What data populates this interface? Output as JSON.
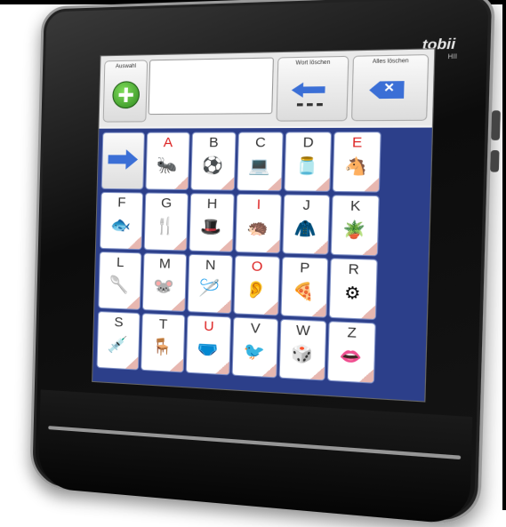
{
  "device": {
    "brand": "tobii",
    "model": "HII"
  },
  "topbar": {
    "choose_label": "Auswahl",
    "delete_word_label": "Wort löschen",
    "delete_all_label": "Alles löschen",
    "message_text": ""
  },
  "grid": {
    "next_label": "",
    "rows": [
      [
        {
          "letter": "A",
          "red": true,
          "icon": "ant"
        },
        {
          "letter": "B",
          "red": false,
          "icon": "ball"
        },
        {
          "letter": "C",
          "red": false,
          "icon": "computer"
        },
        {
          "letter": "D",
          "red": false,
          "icon": "jar"
        },
        {
          "letter": "E",
          "red": true,
          "icon": "donkey"
        }
      ],
      [
        {
          "letter": "F",
          "red": false,
          "icon": "fish"
        },
        {
          "letter": "G",
          "red": false,
          "icon": "fork"
        },
        {
          "letter": "H",
          "red": false,
          "icon": "hat"
        },
        {
          "letter": "I",
          "red": true,
          "icon": "hedgehog"
        },
        {
          "letter": "J",
          "red": false,
          "icon": "jacket"
        },
        {
          "letter": "K",
          "red": false,
          "icon": "watering-can"
        }
      ],
      [
        {
          "letter": "L",
          "red": false,
          "icon": "spoon"
        },
        {
          "letter": "M",
          "red": false,
          "icon": "mouse"
        },
        {
          "letter": "N",
          "red": false,
          "icon": "needle"
        },
        {
          "letter": "O",
          "red": true,
          "icon": "ear"
        },
        {
          "letter": "P",
          "red": false,
          "icon": "pizza"
        },
        {
          "letter": "R",
          "red": false,
          "icon": "wheel"
        }
      ],
      [
        {
          "letter": "S",
          "red": false,
          "icon": "syringe"
        },
        {
          "letter": "T",
          "red": false,
          "icon": "table"
        },
        {
          "letter": "U",
          "red": true,
          "icon": "underwear"
        },
        {
          "letter": "V",
          "red": false,
          "icon": "bird"
        },
        {
          "letter": "W",
          "red": false,
          "icon": "dice"
        },
        {
          "letter": "Z",
          "red": false,
          "icon": "mouth"
        }
      ]
    ]
  },
  "colors": {
    "grid_background": "#2c3f8a",
    "red_letter": "#d22222",
    "accent_arrow": "#3b6fd6"
  }
}
